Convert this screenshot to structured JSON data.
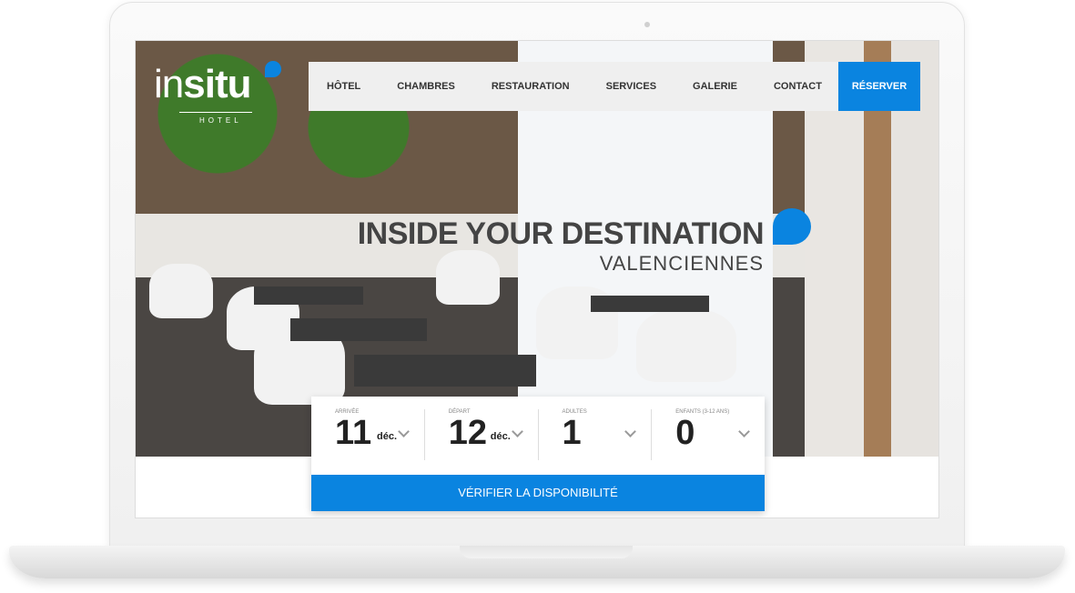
{
  "logo": {
    "brand_light": "in",
    "brand_bold": "situ",
    "subtitle": "HOTEL"
  },
  "nav": {
    "items": [
      "HÔTEL",
      "CHAMBRES",
      "RESTAURATION",
      "SERVICES",
      "GALERIE",
      "CONTACT"
    ],
    "language_icon": "flag-fr-icon",
    "reserve": "RÉSERVER"
  },
  "hero": {
    "title": "INSIDE YOUR DESTINATION",
    "subtitle": "VALENCIENNES"
  },
  "booking": {
    "arrival": {
      "label": "ARRIVÉE",
      "day": "11",
      "month": "déc."
    },
    "departure": {
      "label": "DÉPART",
      "day": "12",
      "month": "déc."
    },
    "adults": {
      "label": "ADULTES",
      "value": "1"
    },
    "children": {
      "label": "ENFANTS (3-12 ANS)",
      "value": "0"
    },
    "submit": "VÉRIFIER LA DISPONIBILITÉ"
  },
  "colors": {
    "accent": "#0a84e0"
  }
}
